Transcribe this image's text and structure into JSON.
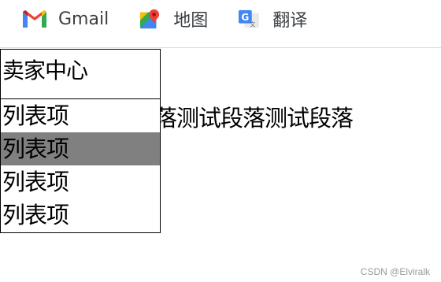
{
  "bookmarks": [
    {
      "icon": "gmail-icon",
      "label": "Gmail"
    },
    {
      "icon": "maps-icon",
      "label": "地图"
    },
    {
      "icon": "translate-icon",
      "label": "翻译"
    }
  ],
  "paragraph": "测试段落测试段落测试段落测试段落",
  "menu": {
    "header": "卖家中心",
    "items": [
      "列表项",
      "列表项",
      "列表项",
      "列表项"
    ],
    "active_index": 1
  },
  "watermark": "CSDN @Elviralk",
  "colors": {
    "active_item_bg": "#808080",
    "border": "#000000"
  }
}
